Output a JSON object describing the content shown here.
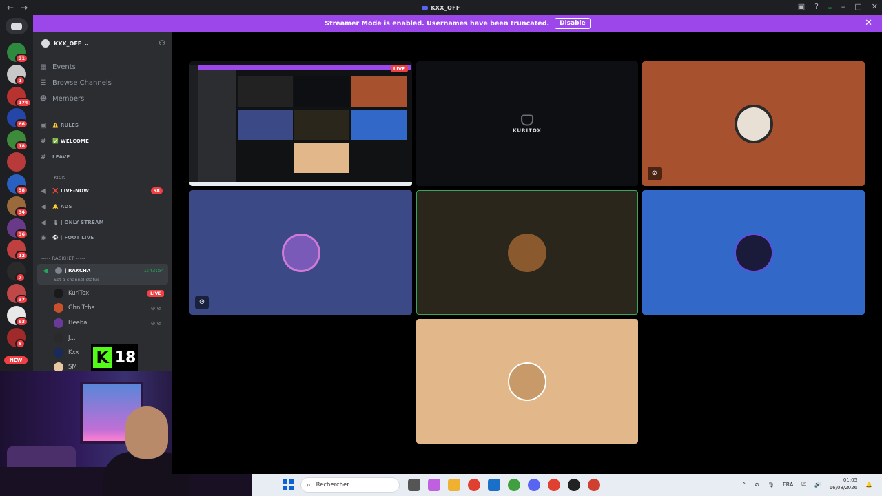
{
  "titlebar": {
    "title": "KXX_OFF"
  },
  "banner": {
    "message": "Streamer Mode is enabled. Usernames have been truncated.",
    "disable_label": "Disable"
  },
  "servers": [
    {
      "badge": "21",
      "color": "#2d8a3e"
    },
    {
      "badge": "1",
      "color": "#c8c8c8"
    },
    {
      "badge": "174",
      "color": "#b8322f"
    },
    {
      "badge": "66",
      "color": "#2446a8"
    },
    {
      "badge": "18",
      "color": "#3c8a3a"
    },
    {
      "badge": "",
      "color": "#b83a3a"
    },
    {
      "badge": "58",
      "color": "#2a60c0"
    },
    {
      "badge": "34",
      "color": "#9a6a3a"
    },
    {
      "badge": "36",
      "color": "#6a3a8a"
    },
    {
      "badge": "12",
      "color": "#c04040"
    },
    {
      "badge": "7",
      "color": "#2a2a2a"
    },
    {
      "badge": "37",
      "color": "#c04848"
    },
    {
      "badge": "93",
      "color": "#e8e8e8"
    },
    {
      "badge": "5",
      "color": "#a02a2a"
    }
  ],
  "rail": {
    "new_label": "NEW"
  },
  "sidebar": {
    "server_name": "KXX_OFF",
    "nav": [
      {
        "label": "Events",
        "icon": "calendar-icon"
      },
      {
        "label": "Browse Channels",
        "icon": "channels-icon"
      },
      {
        "label": "Members",
        "icon": "members-icon"
      }
    ],
    "channels_top": [
      {
        "label": "RULES",
        "emoji": "⚠️",
        "icon": "rules-icon"
      },
      {
        "label": "WELCOME",
        "emoji": "✅",
        "icon": "hash-icon"
      },
      {
        "label": "LEAVE",
        "emoji": "",
        "icon": "hash-icon"
      }
    ],
    "category_kick": "------ KICK ------",
    "channels_kick": [
      {
        "label": "LIVE-NOW",
        "emoji": "❌",
        "count": "58"
      },
      {
        "label": "ADS",
        "emoji": "🔔",
        "count": ""
      },
      {
        "label": "| ONLY STREAM",
        "emoji": "🎙",
        "count": ""
      },
      {
        "label": "| FOOT LIVE",
        "emoji": "⚽",
        "count": ""
      }
    ],
    "category_racket": "----- RACKHET -----",
    "voice": {
      "name": "| RAKCHA",
      "timer": "1:43:54",
      "status": "Set a channel status",
      "users": [
        {
          "name": "KuriTox",
          "live": "LIVE",
          "color": "#1a1a1a"
        },
        {
          "name": "GhniTcha",
          "live": "",
          "color": "#c8502a"
        },
        {
          "name": "Heeba",
          "live": "",
          "color": "#6a3a9a"
        },
        {
          "name": "J...",
          "live": "",
          "color": "#2a2a2a"
        },
        {
          "name": "Kxx",
          "live": "",
          "color": "#1a2a5a"
        },
        {
          "name": "SM",
          "live": "",
          "color": "#e8c8a0"
        }
      ]
    }
  },
  "kick": {
    "rating": "18"
  },
  "stage": {
    "kuritox_label": "KURITOX",
    "live_label": "LIVE",
    "tiles": [
      {
        "id": "screen",
        "bg": "#111214"
      },
      {
        "id": "kuritox",
        "bg": "#0e0f13"
      },
      {
        "id": "ghnitcha",
        "bg": "#a7512e"
      },
      {
        "id": "heeba",
        "bg": "#3b4a86"
      },
      {
        "id": "j",
        "bg": "#2a261c"
      },
      {
        "id": "kxx",
        "bg": "#3268c8"
      },
      {
        "id": "sm",
        "bg": "#e2b78a"
      }
    ]
  },
  "taskbar": {
    "search_placeholder": "Rechercher",
    "lang": "FRA",
    "time": "01:05",
    "date": "16/08/2026"
  }
}
